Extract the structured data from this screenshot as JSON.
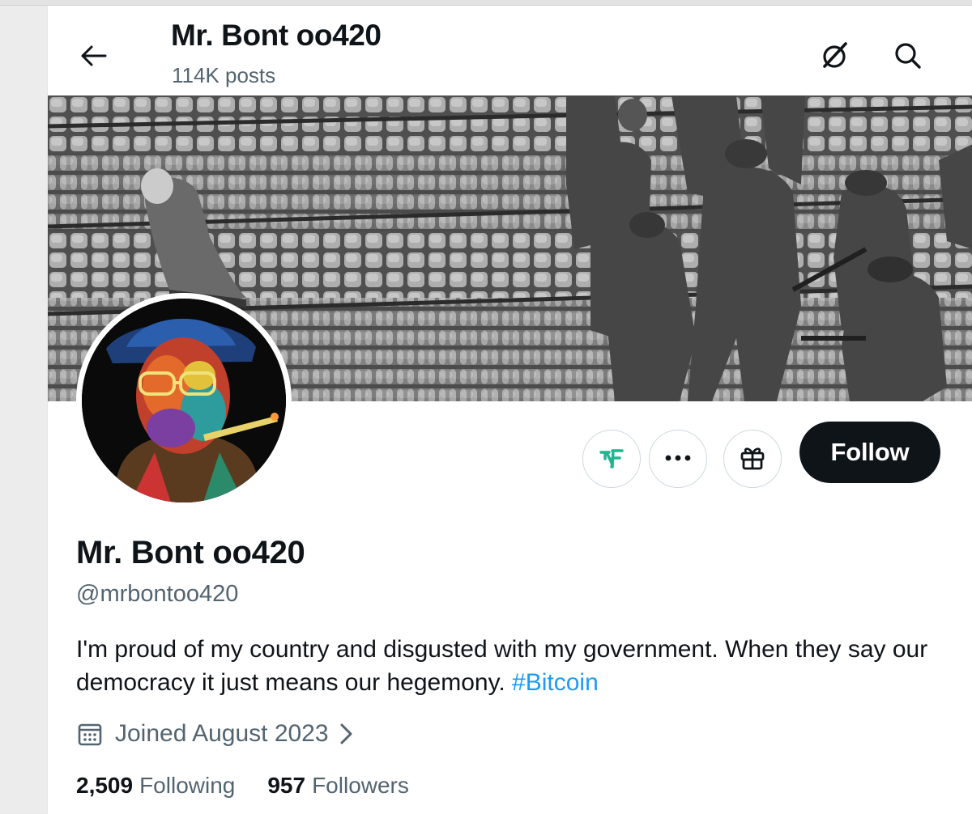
{
  "header": {
    "title": "Mr. Bont oo420",
    "post_count": "114K posts",
    "back_icon": "arrow-left-icon",
    "grok_icon": "grok-icon",
    "search_icon": "search-icon"
  },
  "profile": {
    "display_name": "Mr. Bont oo420",
    "handle": "@mrbontoo420",
    "bio_text": "I'm proud of my country and disgusted with my government. When they say our democracy it just means our hegemony. ",
    "bio_hashtag": "#Bitcoin",
    "joined": "Joined August 2023",
    "following_count": "2,509",
    "following_label": "Following",
    "followers_count": "957",
    "followers_label": "Followers"
  },
  "actions": {
    "follow_label": "Follow",
    "buttons": [
      "tip-app-icon",
      "more-options-icon",
      "gift-icon"
    ]
  },
  "colors": {
    "text": "#0f1419",
    "secondary": "#536471",
    "link": "#1d9bf0",
    "follow_bg": "#0f1419",
    "border": "#cfd9de",
    "tip_accent": "#1fb58f"
  }
}
